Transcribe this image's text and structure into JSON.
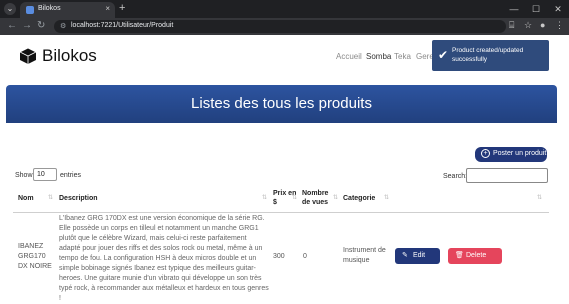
{
  "browser": {
    "tab_title": "Bilokos",
    "url": "localhost:7221/Utilisateur/Produit"
  },
  "navbar": {
    "brand": "Bilokos",
    "links": [
      "Accueil",
      "Somba",
      "Teka",
      "Gere"
    ]
  },
  "toast": {
    "message": "Product created/updated successfully"
  },
  "banner": {
    "title": "Listes des tous les produits"
  },
  "actions": {
    "post_label": "Poster un produit"
  },
  "table_controls": {
    "show_label": "Show",
    "show_value": "10",
    "entries_label": "entries",
    "search_label": "Search:"
  },
  "table": {
    "headers": [
      "Nom",
      "Description",
      "Prix en $",
      "Nombre de vues",
      "Categorie"
    ],
    "rows": [
      {
        "nom": "IBANEZ GRG170 DX NOIRE",
        "description": "L'Ibanez GRG 170DX est une version économique de la série RG. Elle possède un corps en tilleul et notamment un manche GRG1 plutôt que le célèbre Wizard, mais celui-ci reste parfaitement adapté pour jouer des riffs et des solos rock ou metal, même à un tempo de fou. La configuration HSH à deux micros double et un simple bobinage signés Ibanez est typique des meilleurs guitar-heroes. Une guitare munie d'un vibrato qui développe un son très typé rock, à recommander aux métalleux et hardeux en tous genres !",
        "prix": "300",
        "vues": "0",
        "categorie": "Instrument de musique",
        "edit_label": "Edit",
        "delete_label": "Delete"
      }
    ]
  }
}
